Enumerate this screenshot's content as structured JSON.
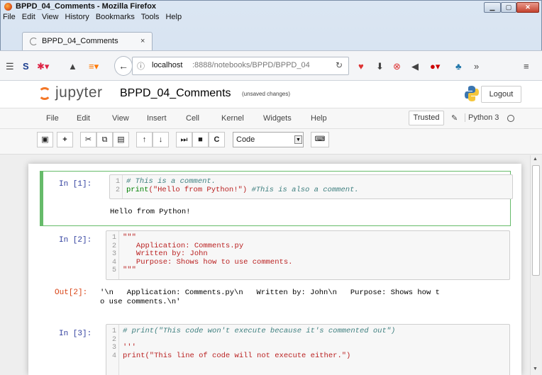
{
  "window": {
    "title": "BPPD_04_Comments - Mozilla Firefox",
    "menu": [
      "File",
      "Edit",
      "View",
      "History",
      "Bookmarks",
      "Tools",
      "Help"
    ]
  },
  "tab": {
    "label": "BPPD_04_Comments",
    "close": "×"
  },
  "navbar": {
    "url_host": "localhost",
    "url_path": ":8888/notebooks/BPPD/BPPD_04",
    "more": "»"
  },
  "jupyter": {
    "logo_text": "jupyter",
    "notebook_name": "BPPD_04_Comments",
    "save_status": "(unsaved changes)",
    "logout_label": "Logout",
    "menu": [
      "File",
      "Edit",
      "View",
      "Insert",
      "Cell",
      "Kernel",
      "Widgets",
      "Help"
    ],
    "trusted_label": "Trusted",
    "kernel_name": "Python 3",
    "cell_type": "Code"
  },
  "cells": [
    {
      "prompt": "In [1]:",
      "line_numbers": "1\n2",
      "output": "Hello from Python!"
    },
    {
      "prompt": "In [2]:",
      "line_numbers": "1\n2\n3\n4\n5",
      "out_prompt": "Out[2]:",
      "output": "'\\n   Application: Comments.py\\n   Written by: John\\n   Purpose: Shows how t\no use comments.\\n'"
    },
    {
      "prompt": "In [3]:",
      "line_numbers": "1\n2\n3\n4"
    }
  ],
  "code": {
    "c1_l1": "# This is a comment.",
    "c1_print": "print",
    "c1_arg": "(\"Hello from Python!\")",
    "c1_cmt": " #This is also a comment.",
    "c2_body": "\"\"\"\n   Application: Comments.py\n   Written by: John\n   Purpose: Shows how to use comments.\n\"\"\"",
    "c3_l1": "# print(\"This code won't execute because it's commented out\")",
    "c3_l3": "'''",
    "c3_l4": "print(\"This line of code will not execute either.\")"
  }
}
